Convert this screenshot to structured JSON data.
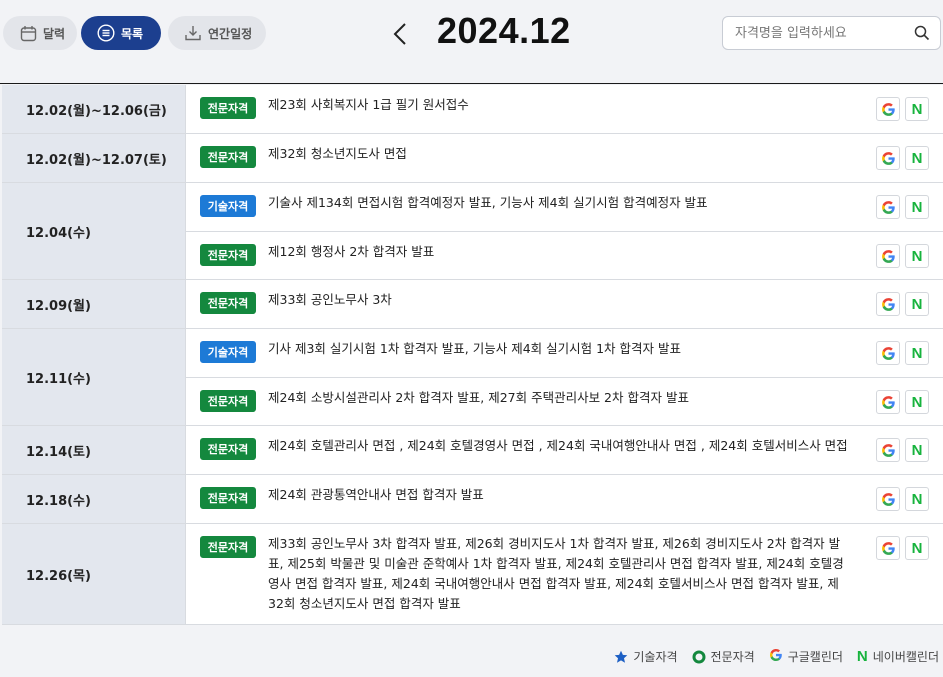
{
  "header": {
    "view_buttons": [
      {
        "label": "달력",
        "icon": "calendar-icon"
      },
      {
        "label": "목록",
        "icon": "list-icon",
        "active": true
      },
      {
        "label": "연간일정",
        "icon": "download-icon"
      }
    ],
    "month": "2024.12",
    "search_placeholder": "자격명을 입력하세요"
  },
  "colors": {
    "accent": "#1c3f8f",
    "professional": "#14883e",
    "technical": "#1d7ad6",
    "naver": "#17b33d"
  },
  "schedule": [
    {
      "date": "12.02(월)~12.06(금)",
      "events": [
        {
          "type": "전문자격",
          "title": "제23회 사회복지사 1급 필기 원서접수"
        }
      ]
    },
    {
      "date": "12.02(월)~12.07(토)",
      "events": [
        {
          "type": "전문자격",
          "title": "제32회 청소년지도사 면접"
        }
      ]
    },
    {
      "date": "12.04(수)",
      "events": [
        {
          "type": "기술자격",
          "title": "기술사 제134회 면접시험 합격예정자 발표, 기능사 제4회 실기시험 합격예정자 발표"
        },
        {
          "type": "전문자격",
          "title": "제12회 행정사 2차 합격자 발표"
        }
      ]
    },
    {
      "date": "12.09(월)",
      "events": [
        {
          "type": "전문자격",
          "title": "제33회 공인노무사 3차"
        }
      ]
    },
    {
      "date": "12.11(수)",
      "events": [
        {
          "type": "기술자격",
          "title": "기사 제3회 실기시험 1차 합격자 발표, 기능사 제4회 실기시험 1차 합격자 발표"
        },
        {
          "type": "전문자격",
          "title": "제24회 소방시설관리사 2차 합격자 발표, 제27회 주택관리사보 2차 합격자 발표"
        }
      ]
    },
    {
      "date": "12.14(토)",
      "events": [
        {
          "type": "전문자격",
          "title": "제24회 호텔관리사 면접 , 제24회 호텔경영사 면접 , 제24회 국내여행안내사 면접 , 제24회 호텔서비스사 면접"
        }
      ]
    },
    {
      "date": "12.18(수)",
      "events": [
        {
          "type": "전문자격",
          "title": "제24회 관광통역안내사 면접 합격자 발표"
        }
      ]
    },
    {
      "date": "12.26(목)",
      "events": [
        {
          "type": "전문자격",
          "title": "제33회 공인노무사 3차 합격자 발표, 제26회 경비지도사 1차 합격자 발표, 제26회 경비지도사 2차 합격자 발표, 제25회 박물관 및 미술관 준학예사 1차 합격자 발표, 제24회 호텔관리사 면접 합격자 발표, 제24회 호텔경영사 면접 합격자 발표, 제24회 국내여행안내사 면접 합격자 발표, 제24회 호텔서비스사 면접 합격자 발표, 제32회 청소년지도사 면접 합격자 발표"
        }
      ]
    }
  ],
  "calendar_buttons": {
    "google": "G",
    "naver": "N"
  },
  "legend": [
    {
      "icon": "star-icon",
      "label": "기술자격"
    },
    {
      "icon": "circle-icon",
      "label": "전문자격"
    },
    {
      "icon": "google-icon",
      "glyph": "G",
      "label": "구글캘린더"
    },
    {
      "icon": "naver-icon",
      "glyph": "N",
      "label": "네이버캘린더"
    }
  ]
}
